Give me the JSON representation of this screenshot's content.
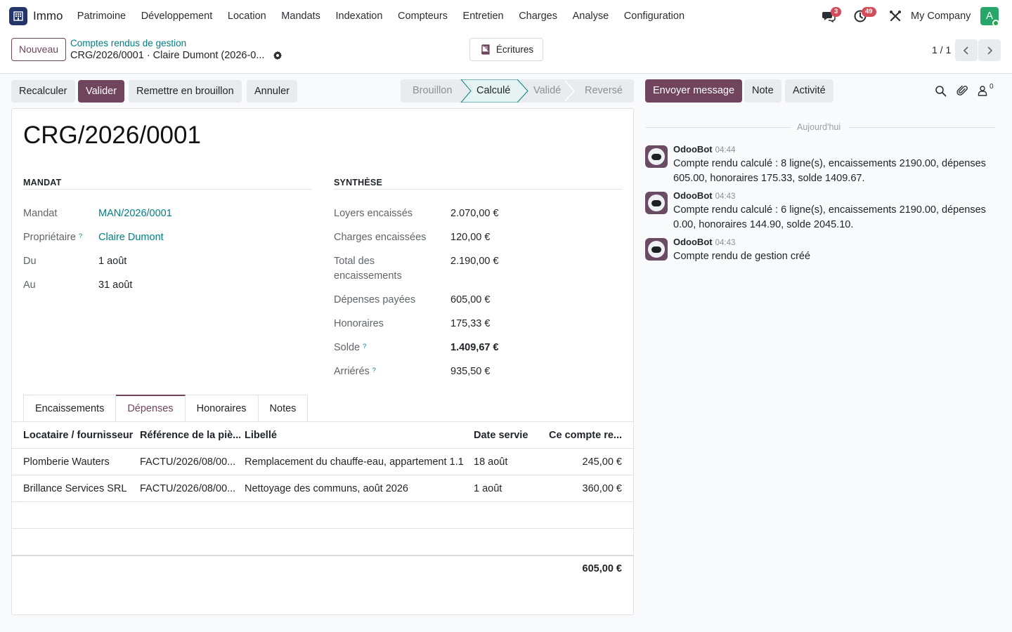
{
  "app": {
    "name": "Immo",
    "menu": [
      "Patrimoine",
      "Développement",
      "Location",
      "Mandats",
      "Indexation",
      "Compteurs",
      "Entretien",
      "Charges",
      "Analyse",
      "Configuration"
    ],
    "messages_badge": "3",
    "activities_badge": "49",
    "company": "My Company",
    "user_initial": "A"
  },
  "control": {
    "new_label": "Nouveau",
    "breadcrumb_parent": "Comptes rendus de gestion",
    "breadcrumb_current": "CRG/2026/0001 · Claire Dumont (2026-0...",
    "ecritures_label": "Écritures",
    "pager": "1 / 1"
  },
  "actions": {
    "recalculer": "Recalculer",
    "valider": "Valider",
    "brouillon": "Remettre en brouillon",
    "annuler": "Annuler"
  },
  "stages": [
    "Brouillon",
    "Calculé",
    "Validé",
    "Reversé"
  ],
  "active_stage": "Calculé",
  "record": {
    "title": "CRG/2026/0001",
    "mandat_group": "MANDAT",
    "synthese_group": "SYNTHÈSE",
    "mandat_label": "Mandat",
    "mandat_value": "MAN/2026/0001",
    "proprietaire_label": "Propriétaire",
    "proprietaire_value": "Claire Dumont",
    "du_label": "Du",
    "du_value": "1 août",
    "au_label": "Au",
    "au_value": "31 août",
    "loyers_label": "Loyers encaissés",
    "loyers_value": "2.070,00 €",
    "charges_label": "Charges encaissées",
    "charges_value": "120,00 €",
    "total_label": "Total des encaissements",
    "total_value": "2.190,00 €",
    "depenses_label": "Dépenses payées",
    "depenses_value": "605,00 €",
    "honoraires_label": "Honoraires",
    "honoraires_value": "175,33 €",
    "solde_label": "Solde",
    "solde_value": "1.409,67 €",
    "arrieres_label": "Arriérés",
    "arrieres_value": "935,50 €",
    "help_mark": "?"
  },
  "tabs": [
    "Encaissements",
    "Dépenses",
    "Honoraires",
    "Notes"
  ],
  "active_tab": "Dépenses",
  "table": {
    "headers": [
      "Locataire / fournisseur",
      "Référence de la piè...",
      "Libellé",
      "Date servie",
      "Ce compte re..."
    ],
    "rows": [
      [
        "Plomberie Wauters",
        "FACTU/2026/08/00...",
        "Remplacement du chauffe-eau, appartement 1.1",
        "18 août",
        "245,00 €"
      ],
      [
        "Brillance Services SRL",
        "FACTU/2026/08/00...",
        "Nettoyage des communs, août 2026",
        "1 août",
        "360,00 €"
      ]
    ],
    "total": "605,00 €"
  },
  "chatter": {
    "send_message": "Envoyer message",
    "note": "Note",
    "activity": "Activité",
    "followers_count": "0",
    "today": "Aujourd'hui",
    "messages": [
      {
        "author": "OdooBot",
        "time": "04:44",
        "body": "Compte rendu calculé : 8 ligne(s), encaissements 2190.00, dépenses 605.00, honoraires 175.33, solde 1409.67."
      },
      {
        "author": "OdooBot",
        "time": "04:43",
        "body": "Compte rendu calculé : 6 ligne(s), encaissements 2190.00, dépenses 0.00, honoraires 144.90, solde 2045.10."
      },
      {
        "author": "OdooBot",
        "time": "04:43",
        "body": "Compte rendu de gestion créé"
      }
    ]
  },
  "colors": {
    "primary": "#71445e",
    "link": "#017e84",
    "badge": "#d44c59",
    "avatar": "#27a66a"
  }
}
